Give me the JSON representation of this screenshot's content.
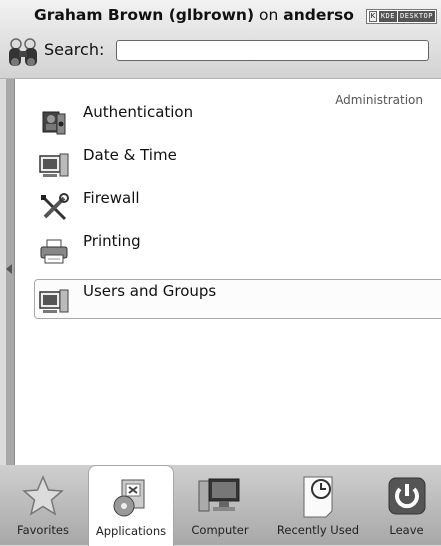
{
  "header": {
    "user_name": "Graham Brown (glbrown)",
    "on_text": "on",
    "host": "anderso",
    "badge_k": "K",
    "badge_text_1": "KDE",
    "badge_text_2": "DESKTOP"
  },
  "search": {
    "label": "Search:",
    "value": "",
    "placeholder": ""
  },
  "main": {
    "section_label": "Administration",
    "items": [
      {
        "label": "Authentication",
        "icon": "id-card-icon"
      },
      {
        "label": "Date & Time",
        "icon": "computer-clock-icon"
      },
      {
        "label": "Firewall",
        "icon": "wrench-screwdriver-icon"
      },
      {
        "label": "Printing",
        "icon": "printer-icon"
      },
      {
        "label": "Users and Groups",
        "icon": "computer-users-icon",
        "selected": true
      }
    ]
  },
  "tabs": [
    {
      "label": "Favorites",
      "icon": "star-icon"
    },
    {
      "label": "Applications",
      "icon": "applications-icon",
      "active": true
    },
    {
      "label": "Computer",
      "icon": "monitor-icon"
    },
    {
      "label": "Recently Used",
      "icon": "recent-document-icon"
    },
    {
      "label": "Leave",
      "icon": "power-icon"
    }
  ]
}
